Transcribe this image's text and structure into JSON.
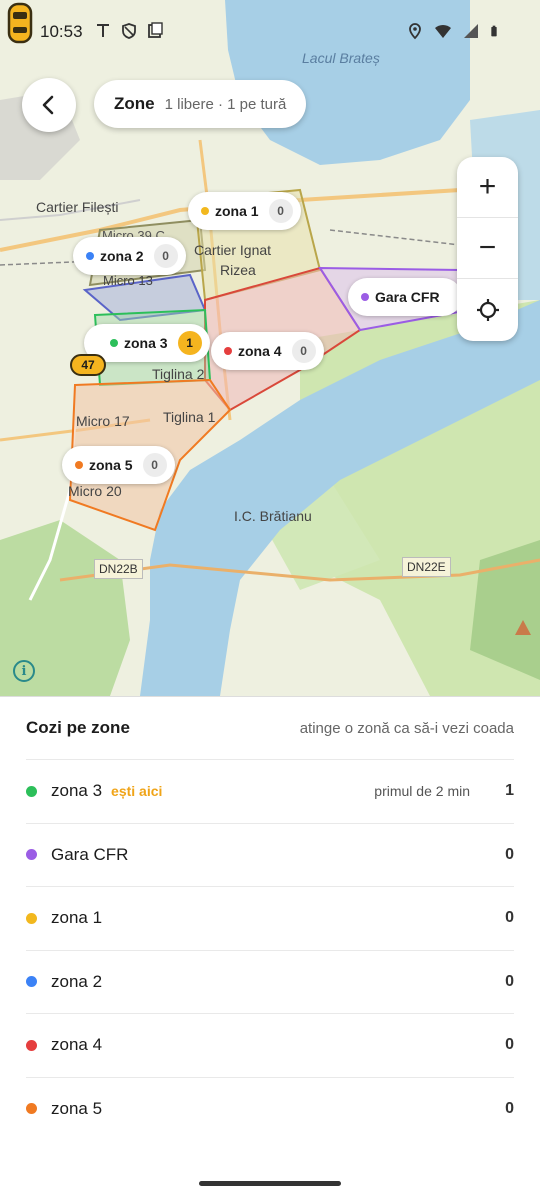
{
  "status_bar": {
    "time": "10:53"
  },
  "header": {
    "title": "Zone",
    "subtitle": "1 libere · 1 pe tură"
  },
  "map": {
    "labels": {
      "lake": "Lacul Brateș",
      "cartier_filesti": "Cartier Filești",
      "micro_39c": "Micro 39 C",
      "cartier_ignat": "Cartier Ignat",
      "rizea": "Rizea",
      "micro_13": "Micro 13",
      "tiglina2": "Tiglina 2",
      "micro_17": "Micro 17",
      "tiglina1": "Tiglina 1",
      "micro_20": "Micro 20",
      "ic_bratianu": "I.C. Brătianu",
      "dn22b": "DN22B",
      "dn22e": "DN22E"
    },
    "chips": [
      {
        "name": "zona 1",
        "count": "0",
        "color": "#f2b81e"
      },
      {
        "name": "zona 2",
        "count": "0",
        "color": "#3b82f6"
      },
      {
        "name": "zona 3",
        "count": "1",
        "color": "#2cbf5a"
      },
      {
        "name": "zona 4",
        "count": "0",
        "color": "#e53e3e"
      },
      {
        "name": "zona 5",
        "count": "0",
        "color": "#f07a22"
      },
      {
        "name": "Gara CFR",
        "count": "",
        "color": "#9b5de5"
      }
    ],
    "car_badge": "47",
    "info_glyph": "i",
    "controls": {
      "zoom_in": "+",
      "zoom_out": "−"
    }
  },
  "sheet": {
    "title": "Cozi pe zone",
    "hint": "atinge o zonă ca să-i vezi coada",
    "rows": [
      {
        "name": "zona 3",
        "tag": "ești aici",
        "sub": "primul de 2 min",
        "count": "1",
        "color": "#2cbf5a"
      },
      {
        "name": "Gara CFR",
        "count": "0",
        "color": "#9b5de5"
      },
      {
        "name": "zona 1",
        "count": "0",
        "color": "#f2b81e"
      },
      {
        "name": "zona 2",
        "count": "0",
        "color": "#3b82f6"
      },
      {
        "name": "zona 4",
        "count": "0",
        "color": "#e53e3e"
      },
      {
        "name": "zona 5",
        "count": "0",
        "color": "#f07a22"
      }
    ]
  }
}
